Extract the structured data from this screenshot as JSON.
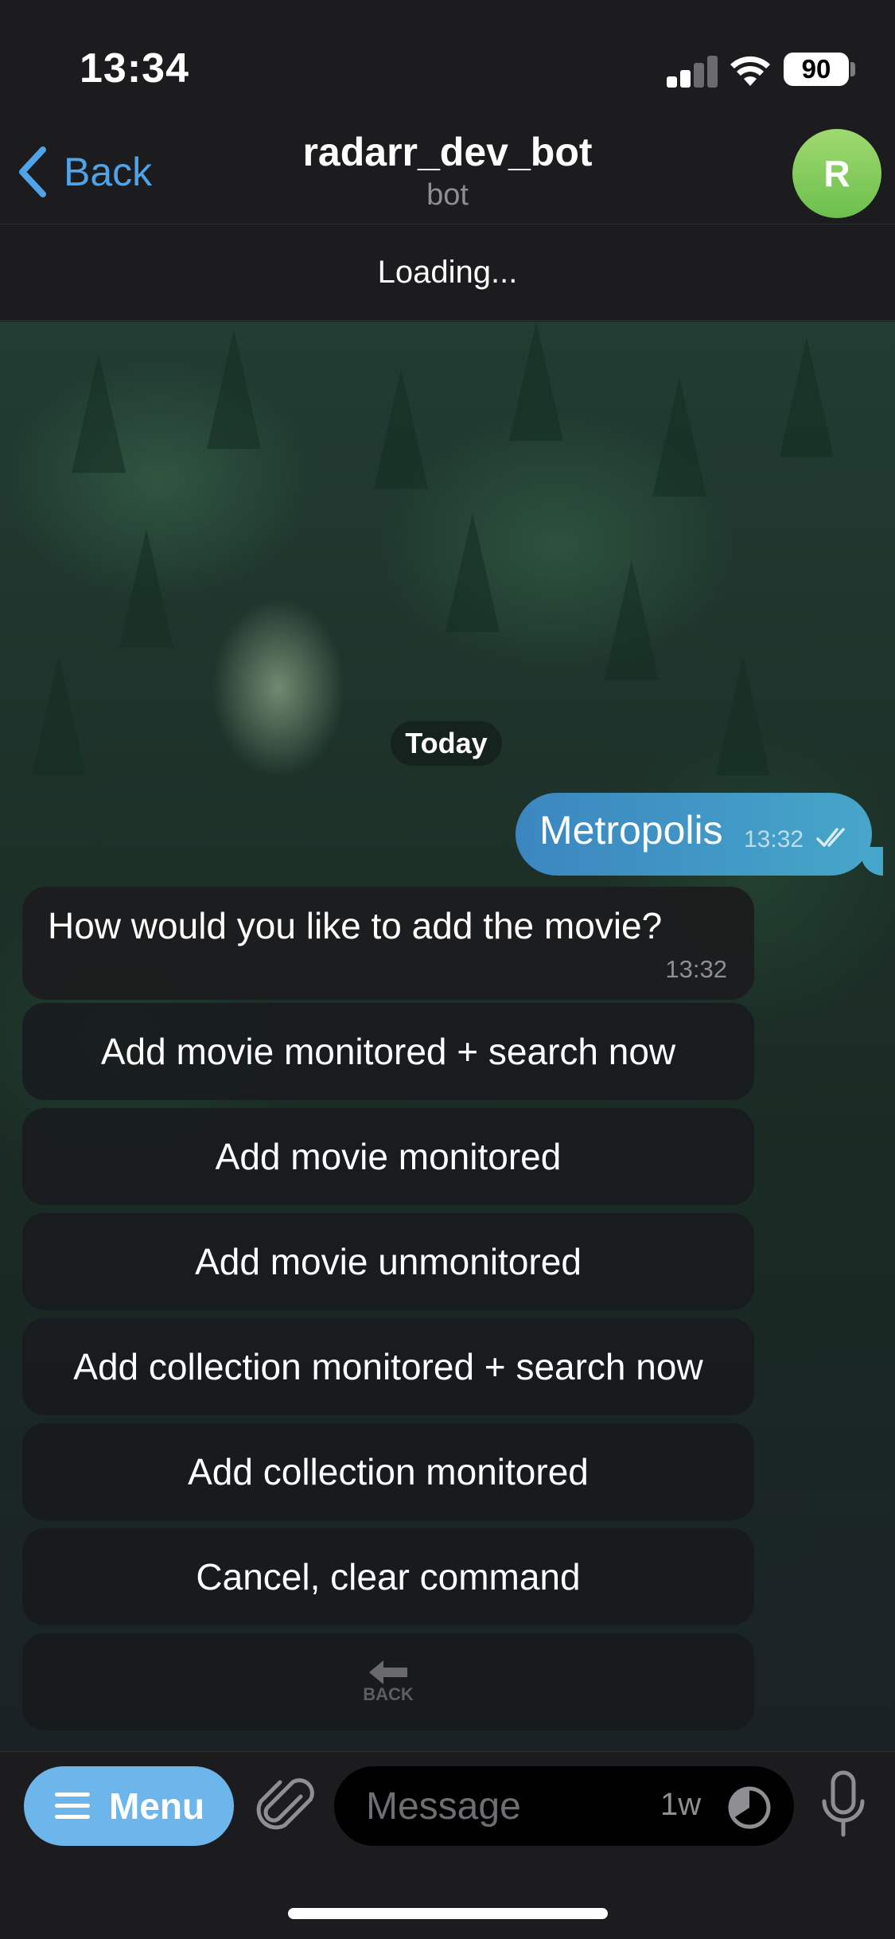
{
  "status_bar": {
    "time": "13:34",
    "battery": "90"
  },
  "header": {
    "back_label": "Back",
    "title": "radarr_dev_bot",
    "subtitle": "bot",
    "avatar_initial": "R"
  },
  "banner": {
    "text": "Loading..."
  },
  "chat": {
    "date_label": "Today",
    "outgoing": {
      "text": "Metropolis",
      "time": "13:32"
    },
    "incoming": {
      "text": "How would you like to add the movie?",
      "time": "13:32"
    },
    "keyboard": [
      {
        "label": "Add movie monitored + search now"
      },
      {
        "label": "Add movie monitored"
      },
      {
        "label": "Add movie unmonitored"
      },
      {
        "label": "Add collection monitored + search now"
      },
      {
        "label": "Add collection monitored"
      },
      {
        "label": "Cancel, clear command"
      }
    ],
    "back_button_label": "BACK"
  },
  "input_bar": {
    "menu_label": "Menu",
    "placeholder": "Message",
    "timer_label": "1w"
  },
  "colors": {
    "accent": "#4fa3e8",
    "menu_button": "#6cb6ec",
    "outgoing_bubble": "#3b86c0",
    "avatar": "#80cc5c"
  }
}
